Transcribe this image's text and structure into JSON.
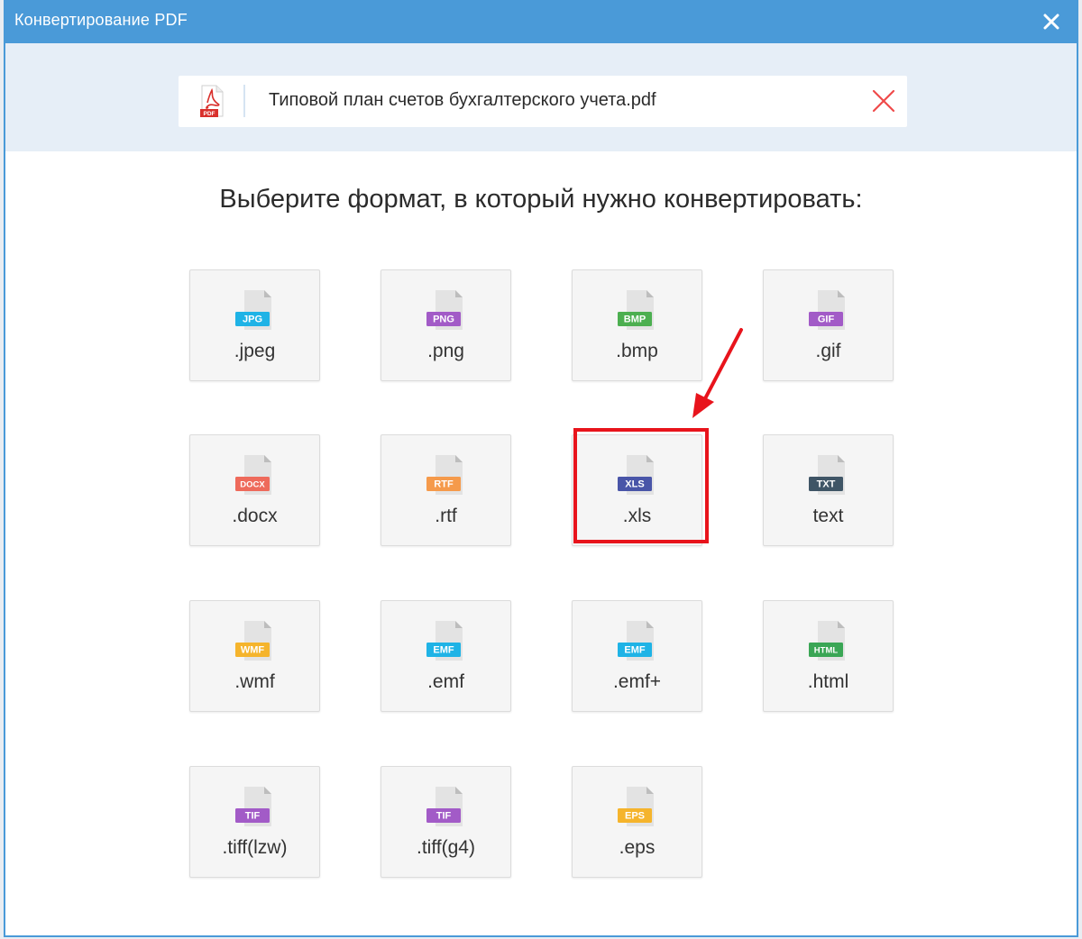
{
  "window": {
    "title": "Конвертирование PDF"
  },
  "file": {
    "name": "Типовой план счетов бухгалтерского учета.pdf",
    "badge": "PDF"
  },
  "heading": "Выберите формат, в который нужно конвертировать:",
  "formats": [
    {
      "badge": "JPG",
      "label": ".jpeg",
      "color": "#1fb3e6"
    },
    {
      "badge": "PNG",
      "label": ".png",
      "color": "#a25bc7"
    },
    {
      "badge": "BMP",
      "label": ".bmp",
      "color": "#4caf50"
    },
    {
      "badge": "GIF",
      "label": ".gif",
      "color": "#a25bc7"
    },
    {
      "badge": "DOCX",
      "label": ".docx",
      "color": "#ee6a5b"
    },
    {
      "badge": "RTF",
      "label": ".rtf",
      "color": "#f59a4b"
    },
    {
      "badge": "XLS",
      "label": ".xls",
      "color": "#4955a8"
    },
    {
      "badge": "TXT",
      "label": "text",
      "color": "#3f5566"
    },
    {
      "badge": "WMF",
      "label": ".wmf",
      "color": "#f5b42c"
    },
    {
      "badge": "EMF",
      "label": ".emf",
      "color": "#1fb3e6"
    },
    {
      "badge": "EMF",
      "label": ".emf+",
      "color": "#1fb3e6"
    },
    {
      "badge": "HTML",
      "label": ".html",
      "color": "#3aa655"
    },
    {
      "badge": "TIF",
      "label": ".tiff(lzw)",
      "color": "#a25bc7"
    },
    {
      "badge": "TIF",
      "label": ".tiff(g4)",
      "color": "#a25bc7"
    },
    {
      "badge": "EPS",
      "label": ".eps",
      "color": "#f5b42c"
    }
  ],
  "colors": {
    "titlebar": "#4a9ad8",
    "highlight": "#e8141c",
    "pdf_red": "#d9302c"
  },
  "icons": {
    "close": "close-icon",
    "remove": "remove-file-icon",
    "pdf": "pdf-file-icon"
  }
}
